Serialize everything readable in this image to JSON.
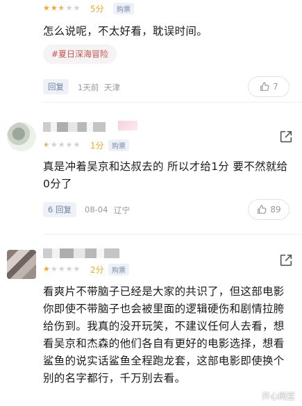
{
  "reviews": [
    {
      "stars": 2.5,
      "score": "5分",
      "badge": "购票",
      "text": "怎么说呢，不太好看，耽误时间。",
      "tag": "#夏日深海冒险",
      "reply_label": "回复",
      "date": "1天前",
      "location": "天津",
      "likes": "7"
    },
    {
      "stars": 0.5,
      "score": "1分",
      "badge": "购票",
      "text": "真是冲着吴京和达叔去的 所以才给1分 要不然就给0分了",
      "reply_label": "6 回复",
      "date": "08-04",
      "location": "辽宁",
      "likes": "89"
    },
    {
      "stars": 1,
      "score": "2分",
      "badge": "购票",
      "text": "看爽片不带脑子已经是大家的共识了，但这部电影你即使不带脑子也会被里面的逻辑硬伤和剧情拉胯给伤到。我真的没开玩笑，不建议任何人去看，想看吴京和杰森的他们各自有更好的电影选择，想看鲨鱼的说实话鲨鱼全程跑龙套，这部电影即使换个别的名字都行，千万别去看。"
    }
  ],
  "watermark": "开心网豆",
  "colors": {
    "star": "#f5a623",
    "tag_text": "#d0504d",
    "reply_text": "#6d7fa0"
  }
}
